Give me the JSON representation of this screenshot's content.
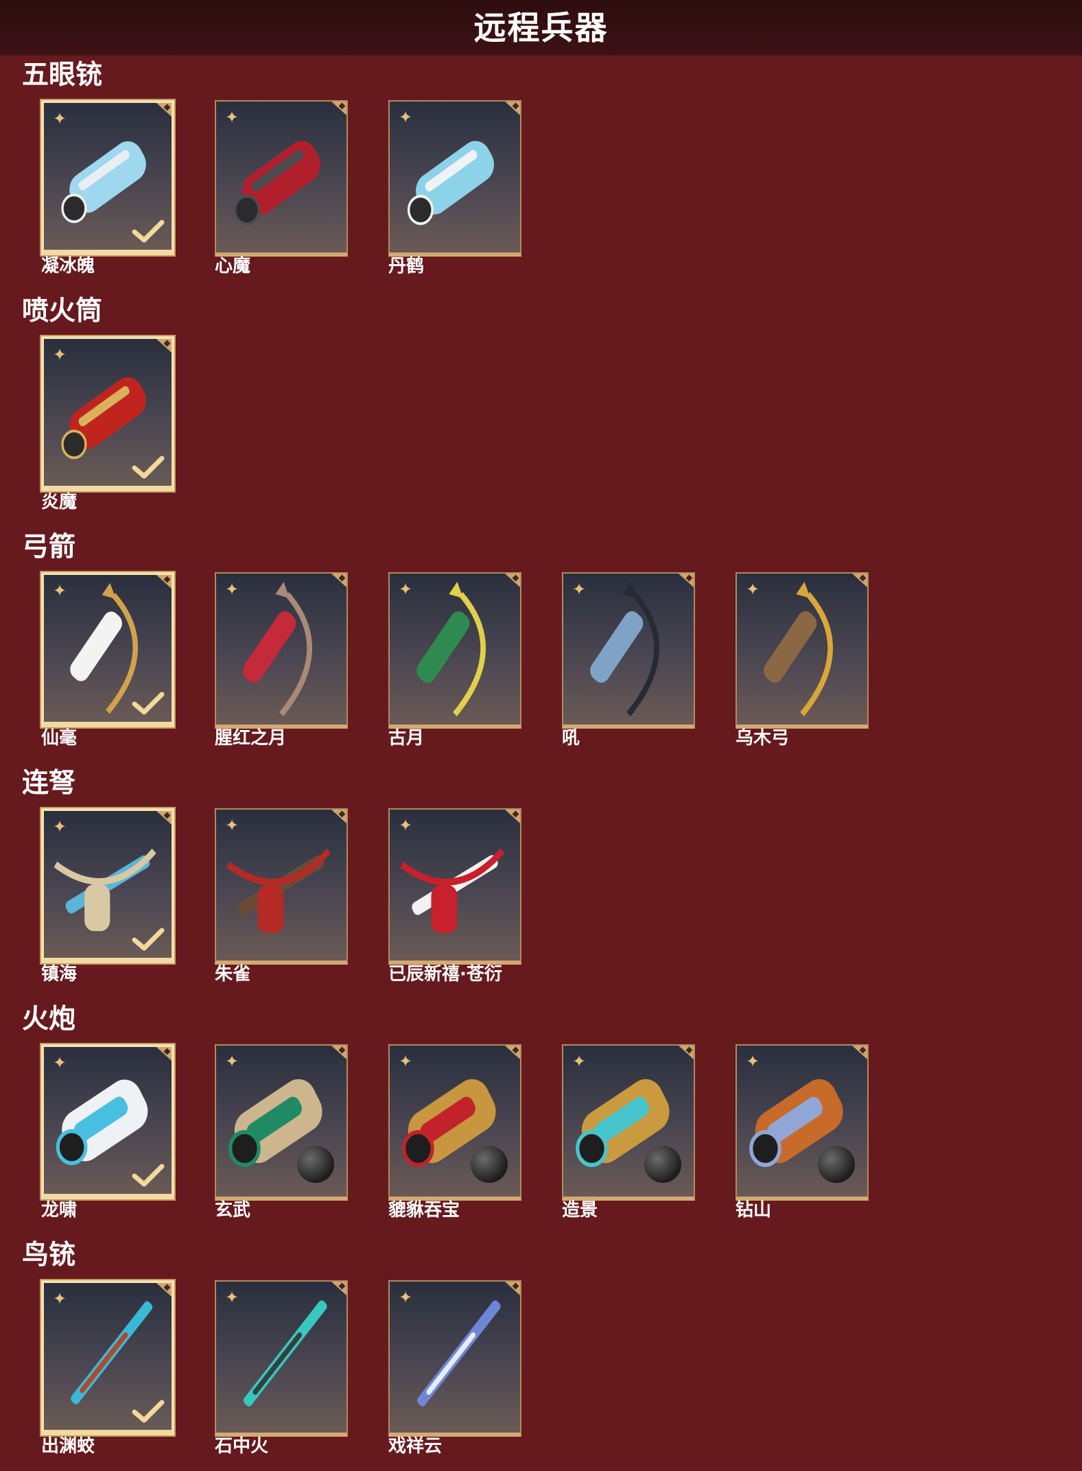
{
  "header": {
    "title": "远程兵器"
  },
  "sections": [
    {
      "title": "五眼铳",
      "items": [
        {
          "name": "凝冰魄",
          "selected": true,
          "accent": "#9fd8ee",
          "trim": "#e9eef2",
          "shape": "gun",
          "ball": false
        },
        {
          "name": "心魔",
          "selected": false,
          "accent": "#b0202c",
          "trim": "#4b4c4f",
          "shape": "gun",
          "ball": false
        },
        {
          "name": "丹鹤",
          "selected": false,
          "accent": "#8cd3ea",
          "trim": "#f0f3f5",
          "shape": "gun",
          "ball": false
        }
      ]
    },
    {
      "title": "喷火筒",
      "items": [
        {
          "name": "炎魔",
          "selected": true,
          "accent": "#c0241f",
          "trim": "#d9b15a",
          "shape": "tube",
          "ball": false
        }
      ]
    },
    {
      "title": "弓箭",
      "items": [
        {
          "name": "仙毫",
          "selected": true,
          "accent": "#f3f3f1",
          "trim": "#d2a24a",
          "shape": "bow",
          "ball": false
        },
        {
          "name": "腥红之月",
          "selected": false,
          "accent": "#c42a3a",
          "trim": "#a88a7a",
          "shape": "bow",
          "ball": false
        },
        {
          "name": "古月",
          "selected": false,
          "accent": "#2f8a4f",
          "trim": "#e0d04a",
          "shape": "bow",
          "ball": false
        },
        {
          "name": "吼",
          "selected": false,
          "accent": "#7fa3c6",
          "trim": "#262b33",
          "shape": "bow",
          "ball": false
        },
        {
          "name": "乌木弓",
          "selected": false,
          "accent": "#8c6744",
          "trim": "#d9a63a",
          "shape": "bow",
          "ball": false
        }
      ]
    },
    {
      "title": "连弩",
      "items": [
        {
          "name": "镇海",
          "selected": true,
          "accent": "#d8c9a2",
          "trim": "#5bb5d8",
          "shape": "crossbow",
          "ball": false
        },
        {
          "name": "朱雀",
          "selected": false,
          "accent": "#b42a24",
          "trim": "#6b4a36",
          "shape": "crossbow",
          "ball": false
        },
        {
          "name": "已辰新禧·苍衍",
          "selected": false,
          "accent": "#c8202c",
          "trim": "#f2f2f2",
          "shape": "crossbow",
          "ball": false
        }
      ]
    },
    {
      "title": "火炮",
      "items": [
        {
          "name": "龙啸",
          "selected": true,
          "accent": "#48bfe0",
          "trim": "#eef2f4",
          "shape": "cannon",
          "ball": false
        },
        {
          "name": "玄武",
          "selected": false,
          "accent": "#1f8a63",
          "trim": "#cdb58e",
          "shape": "cannon",
          "ball": true
        },
        {
          "name": "貔貅吞宝",
          "selected": false,
          "accent": "#c2232a",
          "trim": "#c8963e",
          "shape": "cannon",
          "ball": true
        },
        {
          "name": "造景",
          "selected": false,
          "accent": "#46c6cc",
          "trim": "#c99a3e",
          "shape": "cannon",
          "ball": true
        },
        {
          "name": "钻山",
          "selected": false,
          "accent": "#8fa6d6",
          "trim": "#c86a2a",
          "shape": "cannon",
          "ball": true
        }
      ]
    },
    {
      "title": "鸟铳",
      "items": [
        {
          "name": "出渊蛟",
          "selected": true,
          "accent": "#3ab9d6",
          "trim": "#b2472a",
          "shape": "rifle",
          "ball": false
        },
        {
          "name": "石中火",
          "selected": false,
          "accent": "#37c7c0",
          "trim": "#34423e",
          "shape": "rifle",
          "ball": false
        },
        {
          "name": "戏祥云",
          "selected": false,
          "accent": "#6f86d8",
          "trim": "#e6ecf6",
          "shape": "rifle",
          "ball": false
        }
      ]
    }
  ],
  "colors": {
    "background": "#661a1e",
    "header": "#2e0d0f",
    "frame": "#d5a973",
    "selected_frame": "#f4e2b0"
  },
  "icons": {
    "rarity": "star-icon",
    "equipped": "check-icon",
    "ammo": "cannonball-icon"
  }
}
